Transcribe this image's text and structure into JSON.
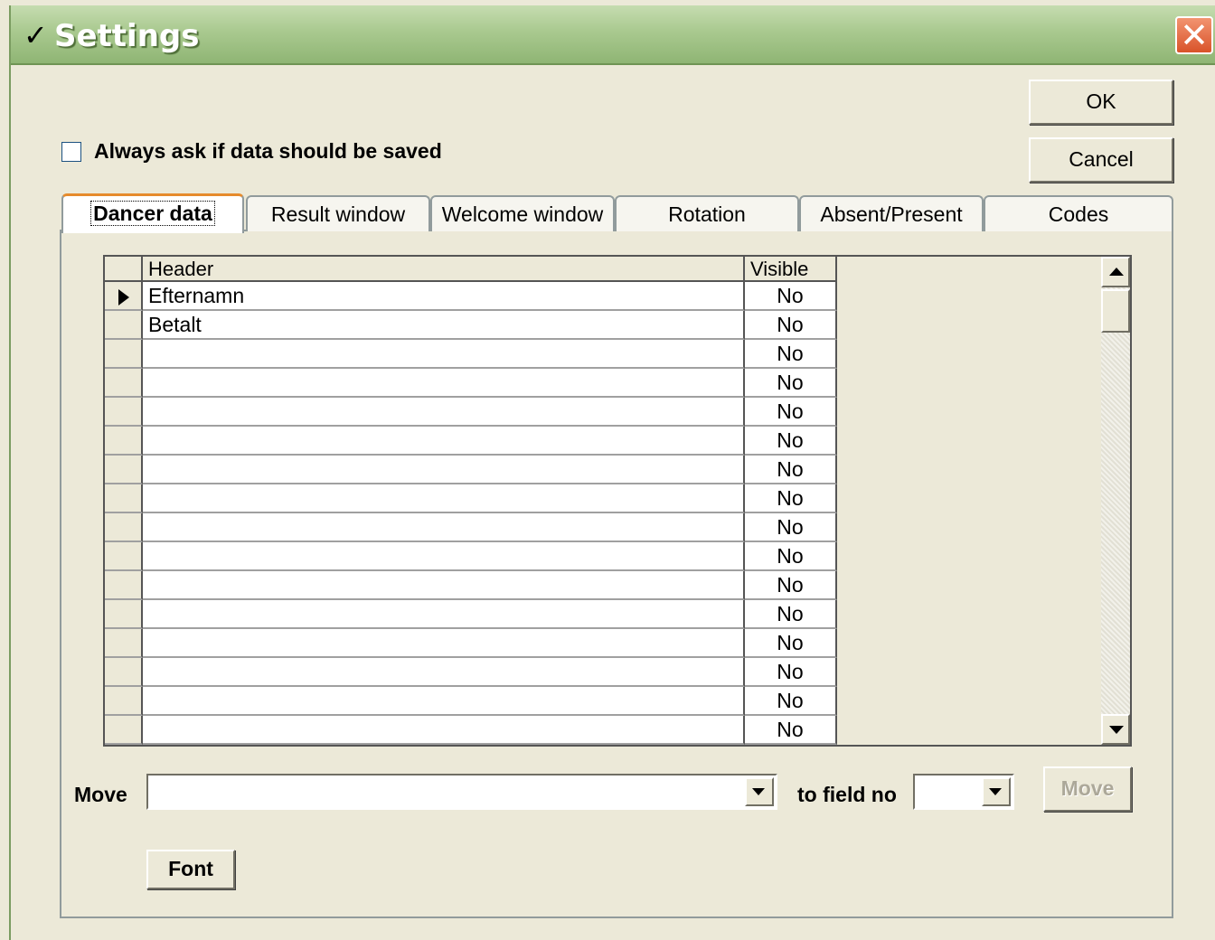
{
  "window": {
    "title": "Settings",
    "title_check": "✓",
    "close_glyph": "✕"
  },
  "buttons": {
    "ok": "OK",
    "cancel": "Cancel",
    "move": "Move",
    "font": "Font"
  },
  "options": {
    "always_ask_label": "Always ask if data should be saved",
    "always_ask_checked": false
  },
  "tabs": [
    {
      "label": "Dancer data",
      "active": true
    },
    {
      "label": "Result window",
      "active": false
    },
    {
      "label": "Welcome window",
      "active": false
    },
    {
      "label": "Rotation",
      "active": false
    },
    {
      "label": "Absent/Present",
      "active": false
    },
    {
      "label": "Codes",
      "active": false
    }
  ],
  "grid": {
    "columns": [
      "Header",
      "Visible"
    ],
    "rows": [
      {
        "header": "Efternamn",
        "visible": "No",
        "current": true
      },
      {
        "header": "Betalt",
        "visible": "No"
      },
      {
        "header": "",
        "visible": "No"
      },
      {
        "header": "",
        "visible": "No"
      },
      {
        "header": "",
        "visible": "No"
      },
      {
        "header": "",
        "visible": "No"
      },
      {
        "header": "",
        "visible": "No"
      },
      {
        "header": "",
        "visible": "No"
      },
      {
        "header": "",
        "visible": "No"
      },
      {
        "header": "",
        "visible": "No"
      },
      {
        "header": "",
        "visible": "No"
      },
      {
        "header": "",
        "visible": "No"
      },
      {
        "header": "",
        "visible": "No"
      },
      {
        "header": "",
        "visible": "No"
      },
      {
        "header": "",
        "visible": "No"
      },
      {
        "header": "",
        "visible": "No"
      }
    ]
  },
  "move": {
    "label": "Move",
    "field_value": "",
    "to_label": "to field no",
    "to_value": ""
  },
  "icons": {
    "check": "check-icon",
    "close": "close-icon",
    "row_pointer": "triangle-right-icon",
    "scroll_up": "arrow-up-icon",
    "scroll_down": "arrow-down-icon",
    "dropdown": "chevron-down-icon"
  },
  "colors": {
    "titlebar": "#a9c98f",
    "background": "#ece9d8",
    "close_button": "#d9532a",
    "active_tab_accent": "#e68b2c"
  }
}
